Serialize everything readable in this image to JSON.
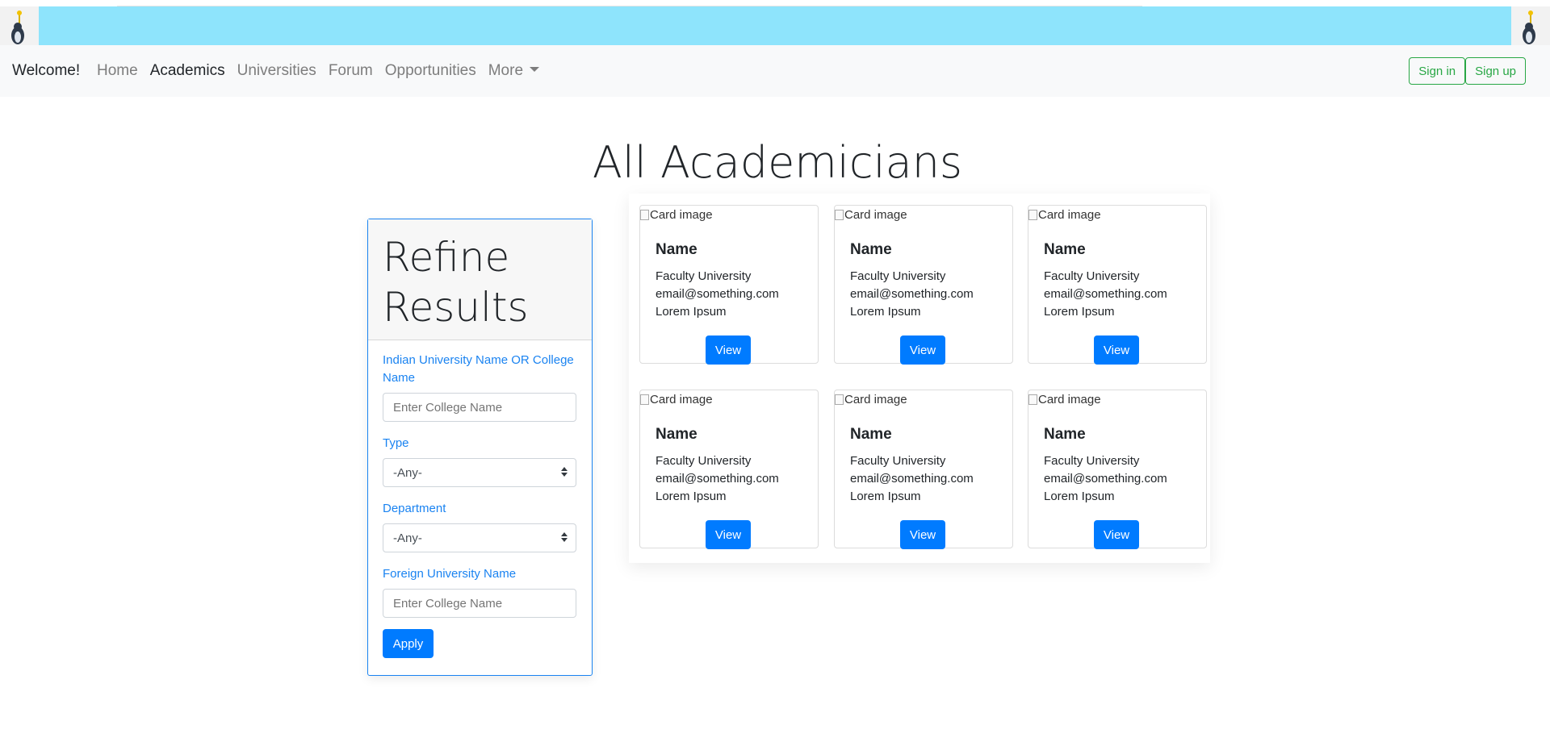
{
  "navbar": {
    "brand": "Welcome!",
    "links": [
      {
        "label": "Home",
        "active": false
      },
      {
        "label": "Academics",
        "active": true
      },
      {
        "label": "Universities",
        "active": false
      },
      {
        "label": "Forum",
        "active": false
      },
      {
        "label": "Opportunities",
        "active": false
      },
      {
        "label": "More",
        "active": false
      }
    ],
    "sign_in": "Sign in",
    "sign_up": "Sign up"
  },
  "banner": {
    "color": "#8ee4fc",
    "icon": "penguin-mascot-icon"
  },
  "page": {
    "title": "All Academicians"
  },
  "refine": {
    "title_line1": "Refine",
    "title_line2": "Results",
    "indian_label": "Indian University Name OR College Name",
    "indian_placeholder": "Enter College Name",
    "type_label": "Type",
    "type_value": "-Any-",
    "department_label": "Department",
    "department_value": "-Any-",
    "foreign_label": "Foreign University Name",
    "foreign_placeholder": "Enter College Name",
    "apply": "Apply"
  },
  "cards": [
    {
      "img_alt": "Card image",
      "name": "Name",
      "line1": "Faculty University",
      "line2": "email@something.com",
      "line3": "Lorem Ipsum",
      "button": "View"
    },
    {
      "img_alt": "Card image",
      "name": "Name",
      "line1": "Faculty University",
      "line2": "email@something.com",
      "line3": "Lorem Ipsum",
      "button": "View"
    },
    {
      "img_alt": "Card image",
      "name": "Name",
      "line1": "Faculty University",
      "line2": "email@something.com",
      "line3": "Lorem Ipsum",
      "button": "View"
    },
    {
      "img_alt": "Card image",
      "name": "Name",
      "line1": "Faculty University",
      "line2": "email@something.com",
      "line3": "Lorem Ipsum",
      "button": "View"
    },
    {
      "img_alt": "Card image",
      "name": "Name",
      "line1": "Faculty University",
      "line2": "email@something.com",
      "line3": "Lorem Ipsum",
      "button": "View"
    },
    {
      "img_alt": "Card image",
      "name": "Name",
      "line1": "Faculty University",
      "line2": "email@something.com",
      "line3": "Lorem Ipsum",
      "button": "View"
    }
  ],
  "colors": {
    "accent": "#007bff",
    "label_blue": "#1a83f1",
    "success": "#28a745",
    "navbar_bg": "#f8f9fa"
  }
}
